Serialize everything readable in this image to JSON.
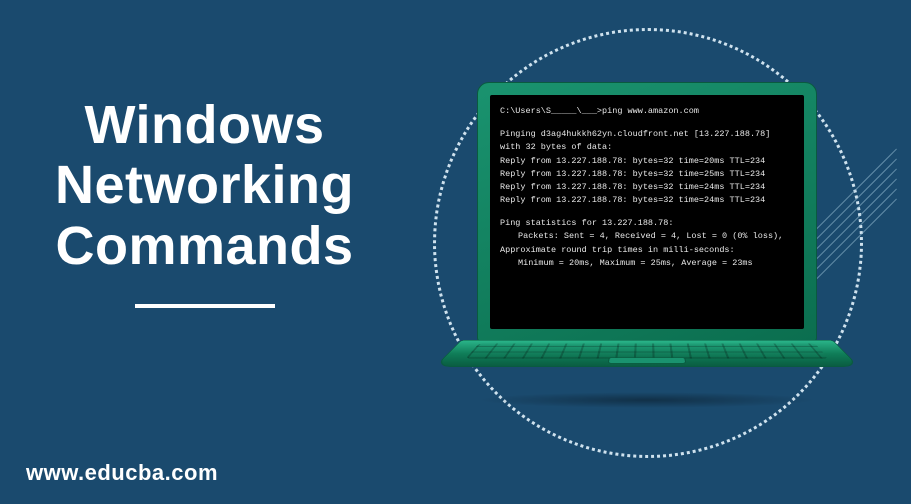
{
  "title": {
    "line1": "Windows",
    "line2": "Networking",
    "line3": "Commands"
  },
  "watermark": "www.educba.com",
  "terminal": {
    "prompt": "C:\\Users\\S_____\\___>ping www.amazon.com",
    "pinging": "Pinging d3ag4hukkh62yn.cloudfront.net [13.227.188.78] with 32 bytes of data:",
    "reply1": "Reply from 13.227.188.78: bytes=32 time=20ms TTL=234",
    "reply2": "Reply from 13.227.188.78: bytes=32 time=25ms TTL=234",
    "reply3": "Reply from 13.227.188.78: bytes=32 time=24ms TTL=234",
    "reply4": "Reply from 13.227.188.78: bytes=32 time=24ms TTL=234",
    "stats_header": "Ping statistics for 13.227.188.78:",
    "stats_packets": "Packets: Sent = 4, Received = 4, Lost = 0 (0% loss),",
    "rt_header": "Approximate round trip times in milli-seconds:",
    "rt_values": "Minimum = 20ms, Maximum = 25ms, Average = 23ms"
  }
}
